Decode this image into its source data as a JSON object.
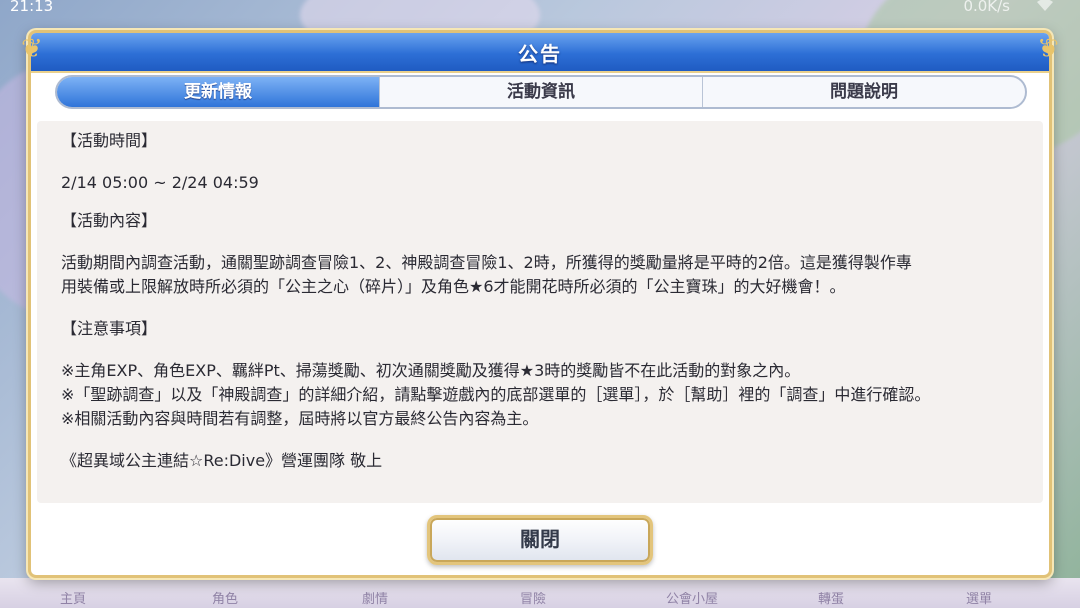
{
  "status_bar": {
    "time": "21:13",
    "network": "0.0K/s",
    "wifi_icon": "wifi-icon"
  },
  "bottom_nav": [
    "主頁",
    "角色",
    "劇情",
    "冒險",
    "公會小屋",
    "轉蛋",
    "選單"
  ],
  "dialog": {
    "title": "公告",
    "tabs": [
      "更新情報",
      "活動資訊",
      "問題說明"
    ],
    "active_tab_index": 0,
    "content": {
      "period_heading": "【活動時間】",
      "period": "2/14 05:00 ~ 2/24 04:59",
      "content_heading": "【活動內容】",
      "content_line1": "活動期間內調查活動，通關聖跡調查冒險1、2、神殿調查冒險1、2時，所獲得的獎勵量將是平時的2倍。這是獲得製作專",
      "content_line2": "用裝備或上限解放時所必須的「公主之心（碎片）」及角色★6才能開花時所必須的「公主寶珠」的大好機會！。",
      "notes_heading": "【注意事項】",
      "note1": "※主角EXP、角色EXP、羈絆Pt、掃蕩獎勵、初次通關獎勵及獲得★3時的獎勵皆不在此活動的對象之內。",
      "note2": "※「聖跡調查」以及「神殿調查」的詳細介紹，請點擊遊戲內的底部選單的［選單］，於［幫助］裡的「調查」中進行確認。",
      "note3": "※相關活動內容與時間若有調整，屆時將以官方最終公告內容為主。",
      "signature": "《超異域公主連結☆Re:Dive》營運團隊 敬上"
    },
    "close_label": "關閉"
  },
  "colors": {
    "header_blue": "#2d6fd6",
    "gold_border": "#e1c277",
    "content_bg": "#f4f1ef"
  }
}
